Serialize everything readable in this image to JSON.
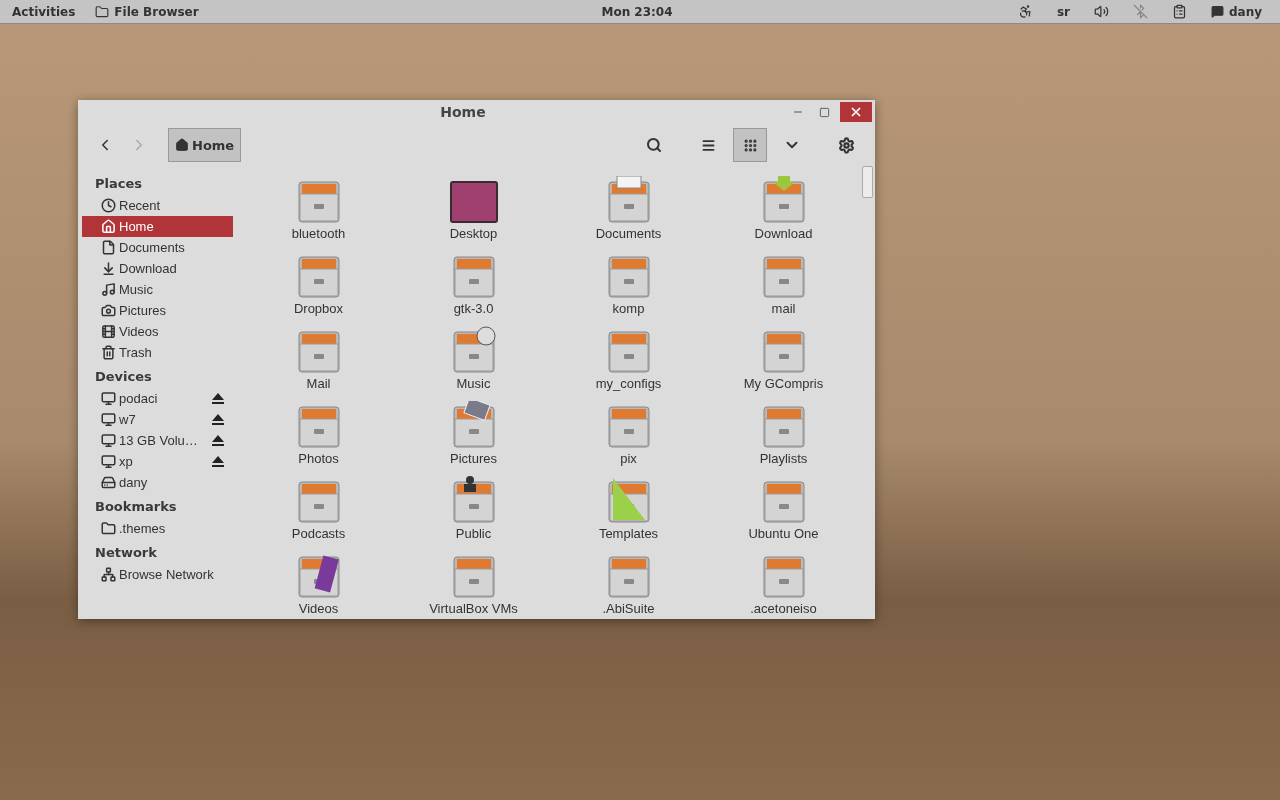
{
  "top_bar": {
    "activities": "Activities",
    "app_name": "File Browser",
    "clock": "Mon 23:04",
    "keyboard_layout": "sr",
    "user": "dany"
  },
  "window": {
    "title": "Home",
    "toolbar": {
      "back": {
        "disabled": false
      },
      "forward": {
        "disabled": true
      },
      "path": [
        {
          "label": "Home",
          "selected": true
        }
      ],
      "views": [
        {
          "kind": "list",
          "selected": false
        },
        {
          "kind": "grid",
          "selected": true
        }
      ]
    },
    "sidebar": [
      {
        "heading": "Places",
        "items": [
          {
            "kind": "recent",
            "label": "Recent",
            "selected": false
          },
          {
            "kind": "home",
            "label": "Home",
            "selected": true
          },
          {
            "kind": "documents",
            "label": "Documents",
            "selected": false
          },
          {
            "kind": "download",
            "label": "Download",
            "selected": false
          },
          {
            "kind": "music",
            "label": "Music",
            "selected": false
          },
          {
            "kind": "pictures",
            "label": "Pictures",
            "selected": false
          },
          {
            "kind": "videos",
            "label": "Videos",
            "selected": false
          },
          {
            "kind": "trash",
            "label": "Trash",
            "selected": false
          }
        ]
      },
      {
        "heading": "Devices",
        "items": [
          {
            "kind": "drive",
            "label": "podaci",
            "selected": false,
            "ejectable": true
          },
          {
            "kind": "drive",
            "label": "w7",
            "selected": false,
            "ejectable": true
          },
          {
            "kind": "drive",
            "label": "13 GB Volu…",
            "selected": false,
            "ejectable": true
          },
          {
            "kind": "drive",
            "label": "xp",
            "selected": false,
            "ejectable": true
          },
          {
            "kind": "disk",
            "label": "dany",
            "selected": false,
            "ejectable": false
          }
        ]
      },
      {
        "heading": "Bookmarks",
        "items": [
          {
            "kind": "folder",
            "label": ".themes",
            "selected": false
          }
        ]
      },
      {
        "heading": "Network",
        "items": [
          {
            "kind": "network",
            "label": "Browse Network",
            "selected": false
          }
        ]
      }
    ],
    "files": [
      {
        "kind": "cabinet",
        "name": "bluetooth"
      },
      {
        "kind": "desktop",
        "name": "Desktop"
      },
      {
        "kind": "documents",
        "name": "Documents"
      },
      {
        "kind": "download",
        "name": "Download"
      },
      {
        "kind": "cabinet",
        "name": "Dropbox"
      },
      {
        "kind": "cabinet",
        "name": "gtk-3.0"
      },
      {
        "kind": "cabinet",
        "name": "komp"
      },
      {
        "kind": "cabinet",
        "name": "mail"
      },
      {
        "kind": "cabinet",
        "name": "Mail"
      },
      {
        "kind": "music",
        "name": "Music"
      },
      {
        "kind": "cabinet",
        "name": "my_configs"
      },
      {
        "kind": "cabinet",
        "name": "My GCompris"
      },
      {
        "kind": "cabinet",
        "name": "Photos"
      },
      {
        "kind": "pictures",
        "name": "Pictures"
      },
      {
        "kind": "cabinet",
        "name": "pix"
      },
      {
        "kind": "cabinet",
        "name": "Playlists"
      },
      {
        "kind": "cabinet",
        "name": "Podcasts"
      },
      {
        "kind": "public",
        "name": "Public"
      },
      {
        "kind": "templates",
        "name": "Templates"
      },
      {
        "kind": "cabinet",
        "name": "Ubuntu One"
      },
      {
        "kind": "videos",
        "name": "Videos"
      },
      {
        "kind": "cabinet",
        "name": "VirtualBox VMs"
      },
      {
        "kind": "cabinet",
        "name": ".AbiSuite"
      },
      {
        "kind": "cabinet",
        "name": ".acetoneiso"
      }
    ]
  }
}
